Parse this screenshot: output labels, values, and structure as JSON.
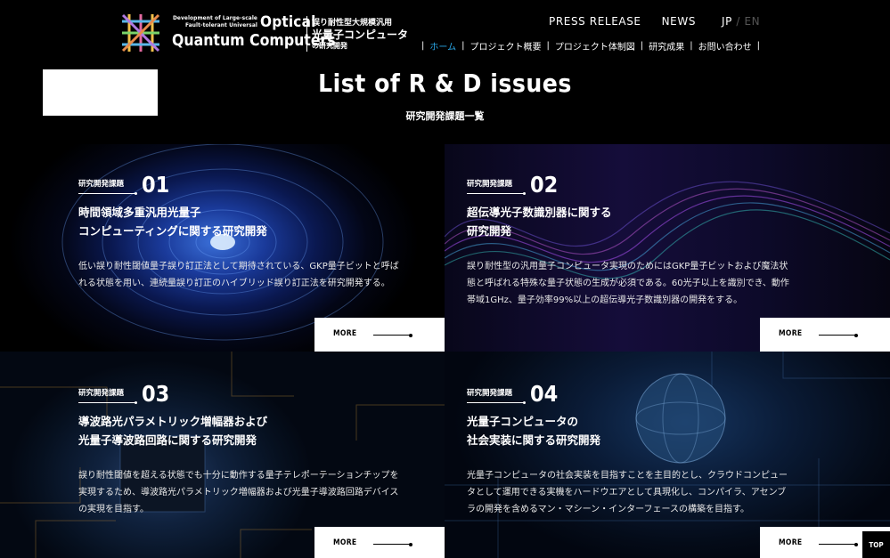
{
  "site": {
    "logo_small": "Development of Large-scale Fault-tolerant Universal",
    "logo_optical": "Optical",
    "logo_qc": "Quantum Computers",
    "logo_jp1": "誤り耐性型大規模汎用",
    "logo_jp2": "光量子コンピュータ",
    "logo_jp3": "の研究開発"
  },
  "top_nav": {
    "press": "PRESS RELEASE",
    "news": "NEWS"
  },
  "lang": {
    "jp": "JP",
    "sep": "/",
    "en": "EN"
  },
  "main_nav": [
    "ホーム",
    "プロジェクト概要",
    "プロジェクト体制図",
    "研究成果",
    "お問い合わせ"
  ],
  "main_nav_sep": "|",
  "page": {
    "title": "List of R & D issues",
    "subtitle": "研究開発課題一覧"
  },
  "cards": [
    {
      "label": "研究開発課題",
      "number": "01",
      "title_lines": [
        "時間領域多重汎用光量子",
        "コンピューティングに関する研究開発"
      ],
      "desc_lines": [
        "低い誤り耐性閾値量子誤り訂正法として期待されている、GKP量子ビットと呼ば",
        "れる状態を用い、連続量誤り訂正のハイブリッド誤り訂正法を研究開発する。"
      ],
      "more": "MORE"
    },
    {
      "label": "研究開発課題",
      "number": "02",
      "title_lines": [
        "超伝導光子数識別器に関する",
        "研究開発"
      ],
      "desc_lines": [
        "誤り耐性型の汎用量子コンピュータ実現のためにはGKP量子ビットおよび魔法状",
        "態と呼ばれる特殊な量子状態の生成が必須である。60光子以上を識別でき、動作",
        "帯域1GHz、量子効率99%以上の超伝導光子数識別器の開発をする。"
      ],
      "more": "MORE"
    },
    {
      "label": "研究開発課題",
      "number": "03",
      "title_lines": [
        "導波路光パラメトリック増幅器および",
        "光量子導波路回路に関する研究開発"
      ],
      "desc_lines": [
        "誤り耐性閾値を超える状態でも十分に動作する量子テレポーテーションチップを",
        "実現するため、導波路光パラメトリック増幅器および光量子導波路回路デバイス",
        "の実現を目指す。"
      ],
      "more": "MORE"
    },
    {
      "label": "研究開発課題",
      "number": "04",
      "title_lines": [
        "光量子コンピュータの",
        "社会実装に関する研究開発"
      ],
      "desc_lines": [
        "光量子コンピュータの社会実装を目指すことを主目的とし、クラウドコンピュー",
        "タとして運用できる実機をハードウエアとして具現化し、コンパイラ、アセンブ",
        "ラの開発を含めるマン・マシーン・インターフェースの構築を目指す。"
      ],
      "more": "MORE"
    }
  ],
  "top_button": "TOP",
  "colors": {
    "active_nav": "#2aa8e8",
    "background": "#000000"
  }
}
